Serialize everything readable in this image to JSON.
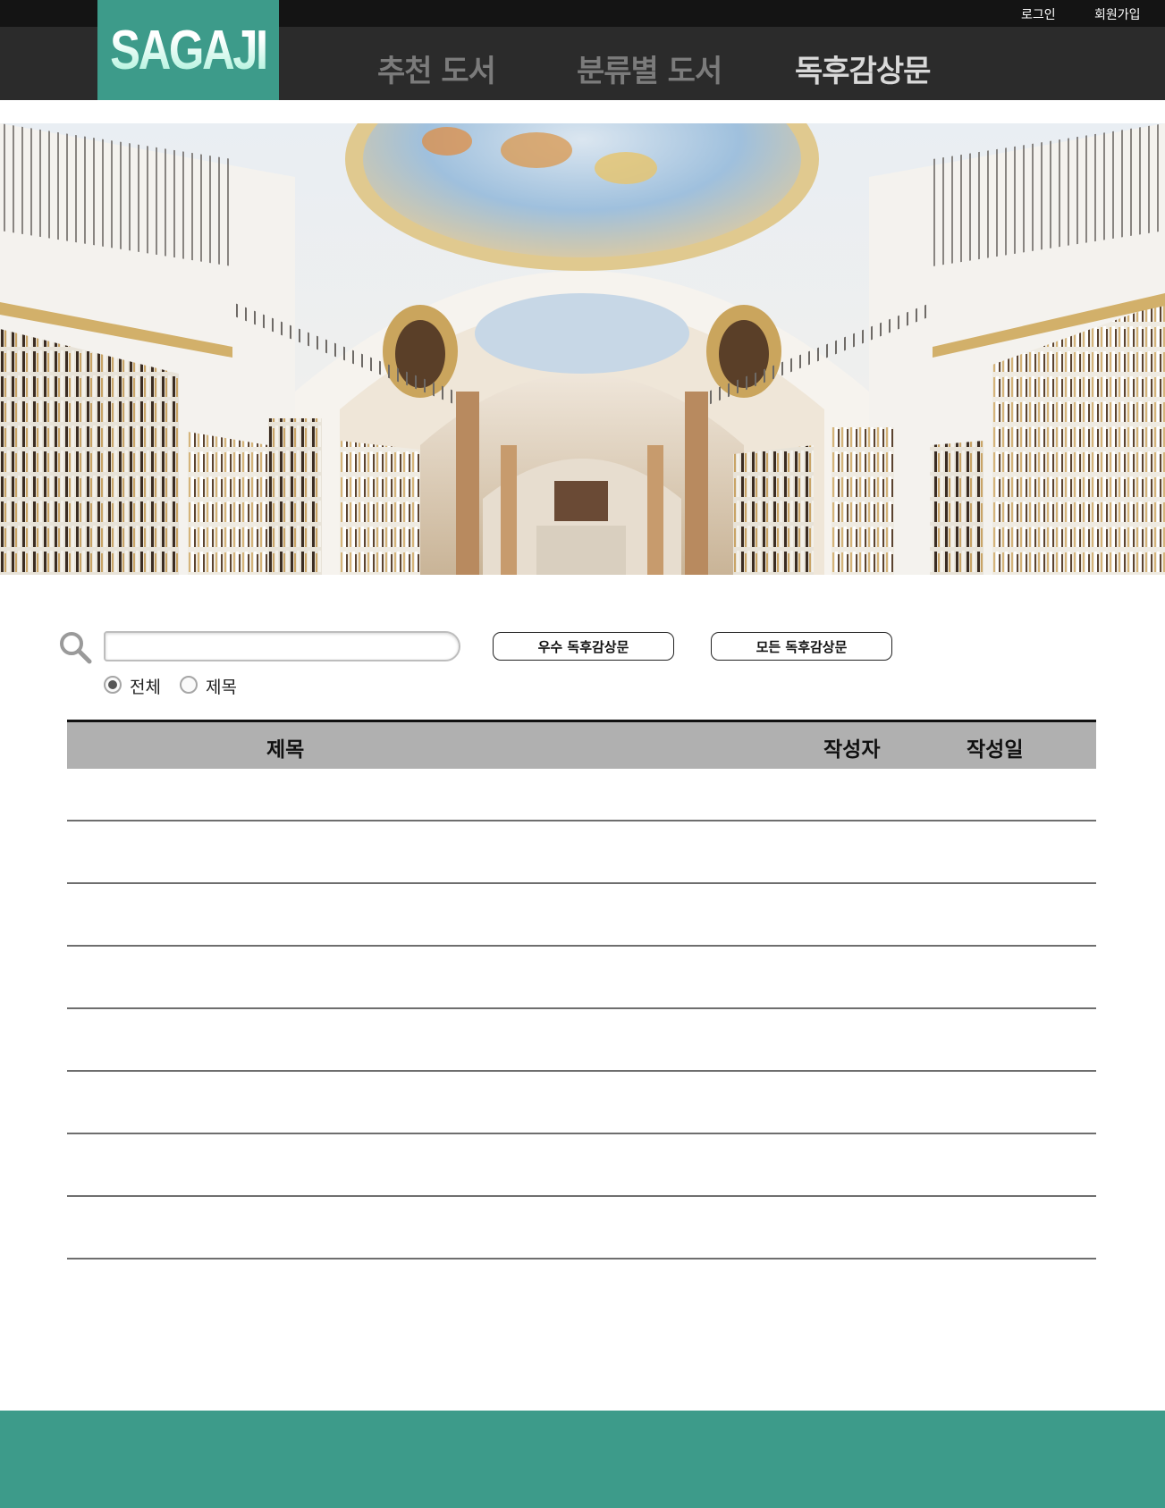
{
  "topbar": {
    "login": "로그인",
    "signup": "회원가입"
  },
  "logo": "SAGAJI",
  "nav": {
    "items": [
      "추천 도서",
      "분류별 도서",
      "독후감상문"
    ],
    "active": "독후감상문"
  },
  "search": {
    "value": "",
    "placeholder": ""
  },
  "buttons": {
    "best_reviews": "우수 독후감상문",
    "all_reviews": "모든 독후감상문"
  },
  "filter": {
    "options": [
      "전체",
      "제목"
    ],
    "selected": "전체"
  },
  "table": {
    "headers": [
      "제목",
      "작성자",
      "작성일"
    ],
    "rows": []
  },
  "colors": {
    "brand": "#3d9b8a",
    "topbar": "#141414",
    "navbar": "#2b2b2b",
    "table_header": "#b0b0b0"
  }
}
